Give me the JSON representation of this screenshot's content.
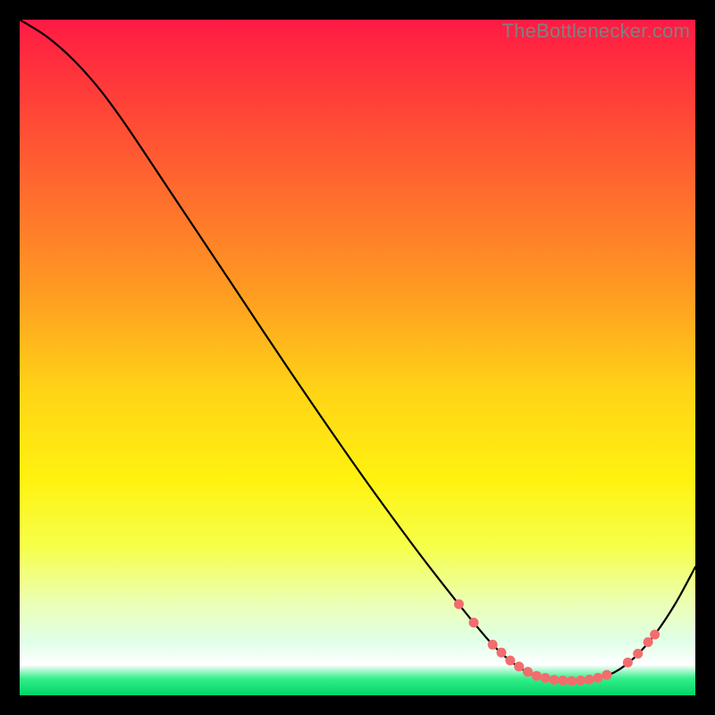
{
  "watermark": "TheBottlenecker.com",
  "chart_data": {
    "type": "line",
    "title": "",
    "xlabel": "",
    "ylabel": "",
    "xlim": [
      0,
      100
    ],
    "ylim": [
      0,
      100
    ],
    "background_gradient": {
      "stops": [
        {
          "offset": 0.0,
          "color": "#ff1a44"
        },
        {
          "offset": 0.1,
          "color": "#ff3a3a"
        },
        {
          "offset": 0.25,
          "color": "#ff6a2e"
        },
        {
          "offset": 0.4,
          "color": "#ff9a22"
        },
        {
          "offset": 0.55,
          "color": "#ffd416"
        },
        {
          "offset": 0.68,
          "color": "#fff210"
        },
        {
          "offset": 0.78,
          "color": "#f6ff4a"
        },
        {
          "offset": 0.86,
          "color": "#ecffb0"
        },
        {
          "offset": 0.92,
          "color": "#e0ffe8"
        },
        {
          "offset": 0.955,
          "color": "#ffffff"
        },
        {
          "offset": 0.975,
          "color": "#34f08a"
        },
        {
          "offset": 1.0,
          "color": "#00d468"
        }
      ]
    },
    "series": [
      {
        "name": "curve",
        "stroke": "#000000",
        "stroke_width": 2.2,
        "points": [
          {
            "x": 0.0,
            "y": 100.0
          },
          {
            "x": 4.0,
            "y": 97.5
          },
          {
            "x": 8.0,
            "y": 94.0
          },
          {
            "x": 12.0,
            "y": 89.5
          },
          {
            "x": 16.0,
            "y": 84.0
          },
          {
            "x": 22.0,
            "y": 75.0
          },
          {
            "x": 30.0,
            "y": 63.0
          },
          {
            "x": 40.0,
            "y": 48.0
          },
          {
            "x": 50.0,
            "y": 33.5
          },
          {
            "x": 58.0,
            "y": 22.5
          },
          {
            "x": 63.0,
            "y": 16.0
          },
          {
            "x": 67.0,
            "y": 11.0
          },
          {
            "x": 70.0,
            "y": 7.5
          },
          {
            "x": 73.0,
            "y": 4.8
          },
          {
            "x": 76.0,
            "y": 3.0
          },
          {
            "x": 79.0,
            "y": 2.3
          },
          {
            "x": 82.0,
            "y": 2.1
          },
          {
            "x": 85.0,
            "y": 2.4
          },
          {
            "x": 88.0,
            "y": 3.4
          },
          {
            "x": 91.0,
            "y": 5.6
          },
          {
            "x": 94.0,
            "y": 9.0
          },
          {
            "x": 97.0,
            "y": 13.5
          },
          {
            "x": 100.0,
            "y": 19.0
          }
        ]
      }
    ],
    "marker_ranges": {
      "color": "#f26d6d",
      "radius": 5.5,
      "x_from": 65.0,
      "x_to": 94.0,
      "cluster_dense_from": 70.0,
      "cluster_dense_to": 88.0
    }
  }
}
